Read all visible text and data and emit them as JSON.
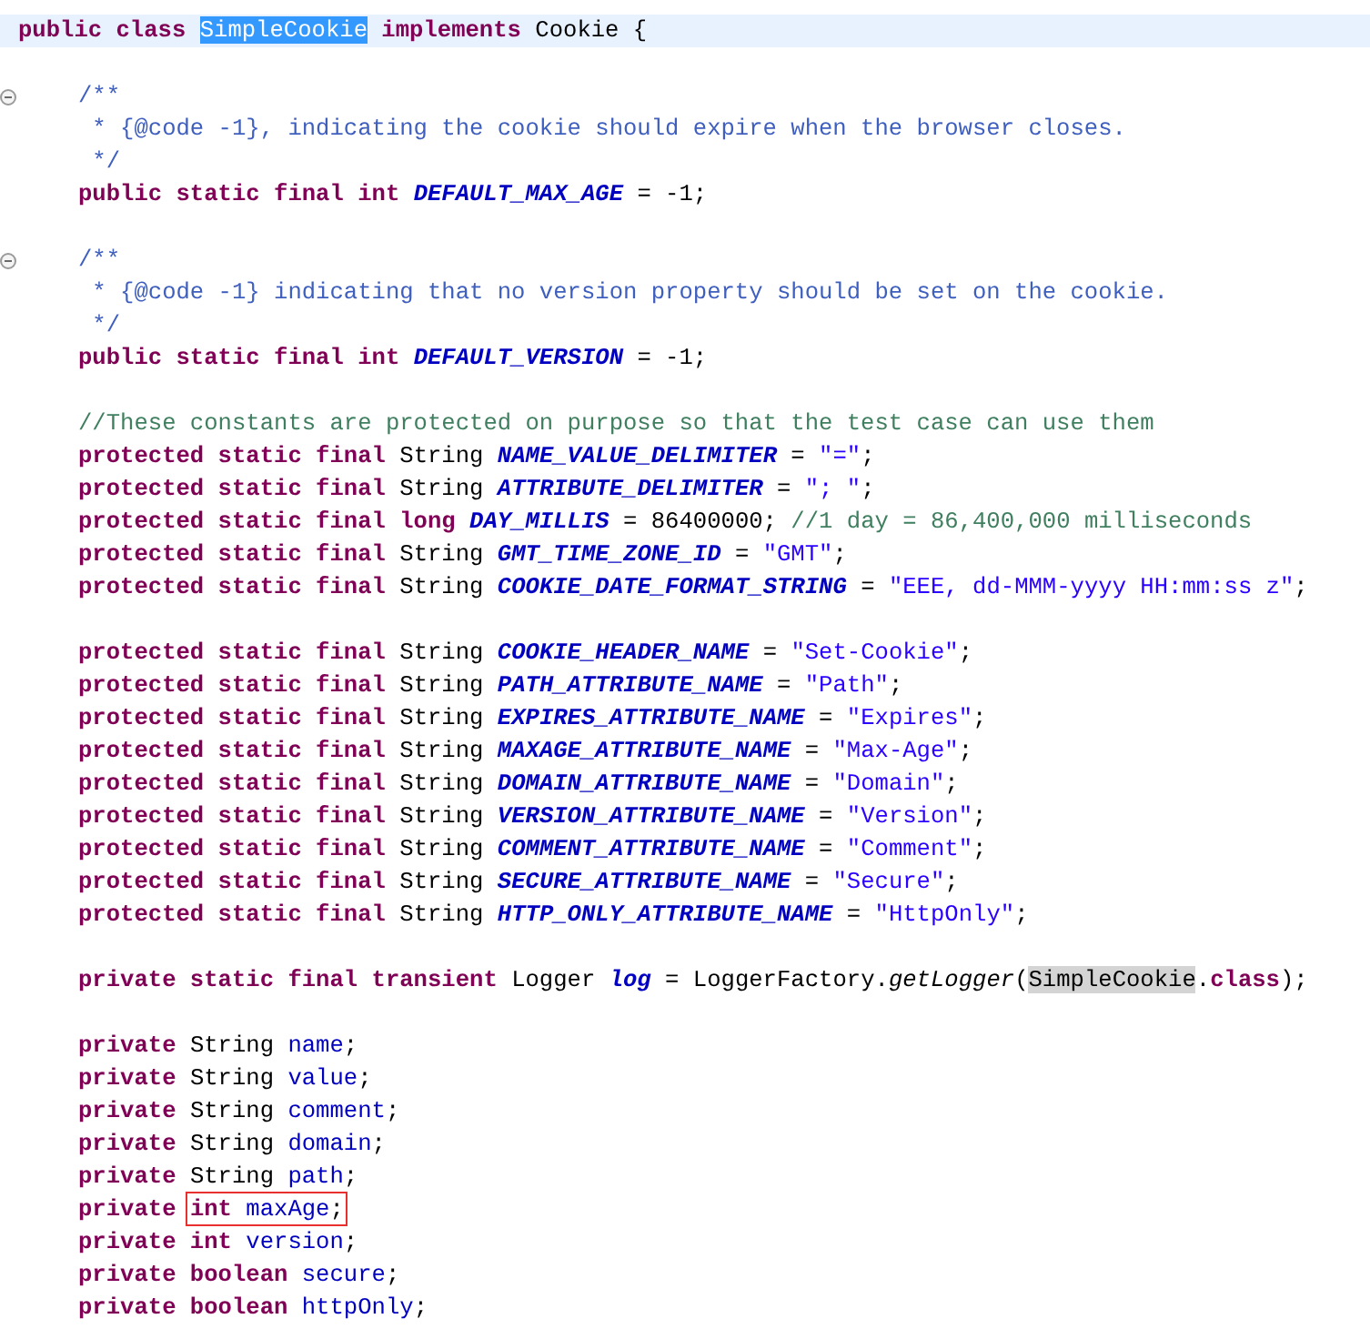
{
  "editor": {
    "lines": [
      {
        "kind": "code",
        "indented": false,
        "current": true,
        "foldable": false,
        "tokens": [
          {
            "kind": "keyword",
            "text": "public class "
          },
          {
            "kind": "plain",
            "text": "SimpleCookie",
            "selected": true
          },
          {
            "kind": "keyword",
            "text": " implements"
          },
          {
            "kind": "plain",
            "text": " Cookie {"
          }
        ]
      },
      {
        "kind": "blank"
      },
      {
        "kind": "code",
        "indented": true,
        "current": false,
        "foldable": true,
        "tokens": [
          {
            "kind": "doc",
            "text": "/**"
          }
        ]
      },
      {
        "kind": "code",
        "indented": true,
        "current": false,
        "foldable": false,
        "tokens": [
          {
            "kind": "doc",
            "text": " * {@code -1}, indicating the cookie should expire when the browser closes."
          }
        ]
      },
      {
        "kind": "code",
        "indented": true,
        "current": false,
        "foldable": false,
        "tokens": [
          {
            "kind": "doc",
            "text": " */"
          }
        ]
      },
      {
        "kind": "code",
        "indented": true,
        "current": false,
        "foldable": false,
        "tokens": [
          {
            "kind": "keyword",
            "text": "public static final int "
          },
          {
            "kind": "constant",
            "text": "DEFAULT_MAX_AGE"
          },
          {
            "kind": "plain",
            "text": " = -1;"
          }
        ]
      },
      {
        "kind": "blank"
      },
      {
        "kind": "code",
        "indented": true,
        "current": false,
        "foldable": true,
        "tokens": [
          {
            "kind": "doc",
            "text": "/**"
          }
        ]
      },
      {
        "kind": "code",
        "indented": true,
        "current": false,
        "foldable": false,
        "tokens": [
          {
            "kind": "doc",
            "text": " * {@code -1} indicating that no version property should be set on the cookie."
          }
        ]
      },
      {
        "kind": "code",
        "indented": true,
        "current": false,
        "foldable": false,
        "tokens": [
          {
            "kind": "doc",
            "text": " */"
          }
        ]
      },
      {
        "kind": "code",
        "indented": true,
        "current": false,
        "foldable": false,
        "tokens": [
          {
            "kind": "keyword",
            "text": "public static final int "
          },
          {
            "kind": "constant",
            "text": "DEFAULT_VERSION"
          },
          {
            "kind": "plain",
            "text": " = -1;"
          }
        ]
      },
      {
        "kind": "blank"
      },
      {
        "kind": "code",
        "indented": true,
        "current": false,
        "foldable": false,
        "tokens": [
          {
            "kind": "comment",
            "text": "//These constants are protected on purpose so that the test case can use them"
          }
        ]
      },
      {
        "kind": "code",
        "indented": true,
        "current": false,
        "foldable": false,
        "tokens": [
          {
            "kind": "keyword",
            "text": "protected static final "
          },
          {
            "kind": "plain",
            "text": "String "
          },
          {
            "kind": "constant",
            "text": "NAME_VALUE_DELIMITER"
          },
          {
            "kind": "plain",
            "text": " = "
          },
          {
            "kind": "string",
            "text": "\"=\""
          },
          {
            "kind": "plain",
            "text": ";"
          }
        ]
      },
      {
        "kind": "code",
        "indented": true,
        "current": false,
        "foldable": false,
        "tokens": [
          {
            "kind": "keyword",
            "text": "protected static final "
          },
          {
            "kind": "plain",
            "text": "String "
          },
          {
            "kind": "constant",
            "text": "ATTRIBUTE_DELIMITER"
          },
          {
            "kind": "plain",
            "text": " = "
          },
          {
            "kind": "string",
            "text": "\"; \""
          },
          {
            "kind": "plain",
            "text": ";"
          }
        ]
      },
      {
        "kind": "code",
        "indented": true,
        "current": false,
        "foldable": false,
        "tokens": [
          {
            "kind": "keyword",
            "text": "protected static final long "
          },
          {
            "kind": "constant",
            "text": "DAY_MILLIS"
          },
          {
            "kind": "plain",
            "text": " = 86400000; "
          },
          {
            "kind": "comment",
            "text": "//1 day = 86,400,000 milliseconds"
          }
        ]
      },
      {
        "kind": "code",
        "indented": true,
        "current": false,
        "foldable": false,
        "tokens": [
          {
            "kind": "keyword",
            "text": "protected static final "
          },
          {
            "kind": "plain",
            "text": "String "
          },
          {
            "kind": "constant",
            "text": "GMT_TIME_ZONE_ID"
          },
          {
            "kind": "plain",
            "text": " = "
          },
          {
            "kind": "string",
            "text": "\"GMT\""
          },
          {
            "kind": "plain",
            "text": ";"
          }
        ]
      },
      {
        "kind": "code",
        "indented": true,
        "current": false,
        "foldable": false,
        "tokens": [
          {
            "kind": "keyword",
            "text": "protected static final "
          },
          {
            "kind": "plain",
            "text": "String "
          },
          {
            "kind": "constant",
            "text": "COOKIE_DATE_FORMAT_STRING"
          },
          {
            "kind": "plain",
            "text": " = "
          },
          {
            "kind": "string",
            "text": "\"EEE, dd-MMM-yyyy HH:mm:ss z\""
          },
          {
            "kind": "plain",
            "text": ";"
          }
        ]
      },
      {
        "kind": "blank"
      },
      {
        "kind": "code",
        "indented": true,
        "current": false,
        "foldable": false,
        "tokens": [
          {
            "kind": "keyword",
            "text": "protected static final "
          },
          {
            "kind": "plain",
            "text": "String "
          },
          {
            "kind": "constant",
            "text": "COOKIE_HEADER_NAME"
          },
          {
            "kind": "plain",
            "text": " = "
          },
          {
            "kind": "string",
            "text": "\"Set-Cookie\""
          },
          {
            "kind": "plain",
            "text": ";"
          }
        ]
      },
      {
        "kind": "code",
        "indented": true,
        "current": false,
        "foldable": false,
        "tokens": [
          {
            "kind": "keyword",
            "text": "protected static final "
          },
          {
            "kind": "plain",
            "text": "String "
          },
          {
            "kind": "constant",
            "text": "PATH_ATTRIBUTE_NAME"
          },
          {
            "kind": "plain",
            "text": " = "
          },
          {
            "kind": "string",
            "text": "\"Path\""
          },
          {
            "kind": "plain",
            "text": ";"
          }
        ]
      },
      {
        "kind": "code",
        "indented": true,
        "current": false,
        "foldable": false,
        "tokens": [
          {
            "kind": "keyword",
            "text": "protected static final "
          },
          {
            "kind": "plain",
            "text": "String "
          },
          {
            "kind": "constant",
            "text": "EXPIRES_ATTRIBUTE_NAME"
          },
          {
            "kind": "plain",
            "text": " = "
          },
          {
            "kind": "string",
            "text": "\"Expires\""
          },
          {
            "kind": "plain",
            "text": ";"
          }
        ]
      },
      {
        "kind": "code",
        "indented": true,
        "current": false,
        "foldable": false,
        "tokens": [
          {
            "kind": "keyword",
            "text": "protected static final "
          },
          {
            "kind": "plain",
            "text": "String "
          },
          {
            "kind": "constant",
            "text": "MAXAGE_ATTRIBUTE_NAME"
          },
          {
            "kind": "plain",
            "text": " = "
          },
          {
            "kind": "string",
            "text": "\"Max-Age\""
          },
          {
            "kind": "plain",
            "text": ";"
          }
        ]
      },
      {
        "kind": "code",
        "indented": true,
        "current": false,
        "foldable": false,
        "tokens": [
          {
            "kind": "keyword",
            "text": "protected static final "
          },
          {
            "kind": "plain",
            "text": "String "
          },
          {
            "kind": "constant",
            "text": "DOMAIN_ATTRIBUTE_NAME"
          },
          {
            "kind": "plain",
            "text": " = "
          },
          {
            "kind": "string",
            "text": "\"Domain\""
          },
          {
            "kind": "plain",
            "text": ";"
          }
        ]
      },
      {
        "kind": "code",
        "indented": true,
        "current": false,
        "foldable": false,
        "tokens": [
          {
            "kind": "keyword",
            "text": "protected static final "
          },
          {
            "kind": "plain",
            "text": "String "
          },
          {
            "kind": "constant",
            "text": "VERSION_ATTRIBUTE_NAME"
          },
          {
            "kind": "plain",
            "text": " = "
          },
          {
            "kind": "string",
            "text": "\"Version\""
          },
          {
            "kind": "plain",
            "text": ";"
          }
        ]
      },
      {
        "kind": "code",
        "indented": true,
        "current": false,
        "foldable": false,
        "tokens": [
          {
            "kind": "keyword",
            "text": "protected static final "
          },
          {
            "kind": "plain",
            "text": "String "
          },
          {
            "kind": "constant",
            "text": "COMMENT_ATTRIBUTE_NAME"
          },
          {
            "kind": "plain",
            "text": " = "
          },
          {
            "kind": "string",
            "text": "\"Comment\""
          },
          {
            "kind": "plain",
            "text": ";"
          }
        ]
      },
      {
        "kind": "code",
        "indented": true,
        "current": false,
        "foldable": false,
        "tokens": [
          {
            "kind": "keyword",
            "text": "protected static final "
          },
          {
            "kind": "plain",
            "text": "String "
          },
          {
            "kind": "constant",
            "text": "SECURE_ATTRIBUTE_NAME"
          },
          {
            "kind": "plain",
            "text": " = "
          },
          {
            "kind": "string",
            "text": "\"Secure\""
          },
          {
            "kind": "plain",
            "text": ";"
          }
        ]
      },
      {
        "kind": "code",
        "indented": true,
        "current": false,
        "foldable": false,
        "tokens": [
          {
            "kind": "keyword",
            "text": "protected static final "
          },
          {
            "kind": "plain",
            "text": "String "
          },
          {
            "kind": "constant",
            "text": "HTTP_ONLY_ATTRIBUTE_NAME"
          },
          {
            "kind": "plain",
            "text": " = "
          },
          {
            "kind": "string",
            "text": "\"HttpOnly\""
          },
          {
            "kind": "plain",
            "text": ";"
          }
        ]
      },
      {
        "kind": "blank"
      },
      {
        "kind": "code",
        "indented": true,
        "current": false,
        "foldable": false,
        "tokens": [
          {
            "kind": "keyword",
            "text": "private static final transient "
          },
          {
            "kind": "plain",
            "text": "Logger "
          },
          {
            "kind": "constant",
            "text": "log"
          },
          {
            "kind": "plain",
            "text": " = LoggerFactory."
          },
          {
            "kind": "static_method",
            "text": "getLogger"
          },
          {
            "kind": "plain",
            "text": "("
          },
          {
            "kind": "plain",
            "text": "SimpleCookie",
            "occurrence_highlight": true
          },
          {
            "kind": "plain",
            "text": "."
          },
          {
            "kind": "keyword",
            "text": "class"
          },
          {
            "kind": "plain",
            "text": ");"
          }
        ]
      },
      {
        "kind": "blank"
      },
      {
        "kind": "code",
        "indented": true,
        "current": false,
        "foldable": false,
        "tokens": [
          {
            "kind": "keyword",
            "text": "private "
          },
          {
            "kind": "plain",
            "text": "String "
          },
          {
            "kind": "field",
            "text": "name"
          },
          {
            "kind": "plain",
            "text": ";"
          }
        ]
      },
      {
        "kind": "code",
        "indented": true,
        "current": false,
        "foldable": false,
        "tokens": [
          {
            "kind": "keyword",
            "text": "private "
          },
          {
            "kind": "plain",
            "text": "String "
          },
          {
            "kind": "field",
            "text": "value"
          },
          {
            "kind": "plain",
            "text": ";"
          }
        ]
      },
      {
        "kind": "code",
        "indented": true,
        "current": false,
        "foldable": false,
        "tokens": [
          {
            "kind": "keyword",
            "text": "private "
          },
          {
            "kind": "plain",
            "text": "String "
          },
          {
            "kind": "field",
            "text": "comment"
          },
          {
            "kind": "plain",
            "text": ";"
          }
        ]
      },
      {
        "kind": "code",
        "indented": true,
        "current": false,
        "foldable": false,
        "tokens": [
          {
            "kind": "keyword",
            "text": "private "
          },
          {
            "kind": "plain",
            "text": "String "
          },
          {
            "kind": "field",
            "text": "domain"
          },
          {
            "kind": "plain",
            "text": ";"
          }
        ]
      },
      {
        "kind": "code",
        "indented": true,
        "current": false,
        "foldable": false,
        "tokens": [
          {
            "kind": "keyword",
            "text": "private "
          },
          {
            "kind": "plain",
            "text": "String "
          },
          {
            "kind": "field",
            "text": "path"
          },
          {
            "kind": "plain",
            "text": ";"
          }
        ]
      },
      {
        "kind": "code",
        "indented": true,
        "current": false,
        "foldable": false,
        "tokens": [
          {
            "kind": "keyword",
            "text": "private "
          },
          {
            "kind": "boxed",
            "children": [
              {
                "kind": "keyword",
                "text": "int "
              },
              {
                "kind": "field",
                "text": "maxAge"
              },
              {
                "kind": "plain",
                "text": ";"
              }
            ]
          }
        ]
      },
      {
        "kind": "code",
        "indented": true,
        "current": false,
        "foldable": false,
        "tokens": [
          {
            "kind": "keyword",
            "text": "private int "
          },
          {
            "kind": "field",
            "text": "version"
          },
          {
            "kind": "plain",
            "text": ";"
          }
        ]
      },
      {
        "kind": "code",
        "indented": true,
        "current": false,
        "foldable": false,
        "tokens": [
          {
            "kind": "keyword",
            "text": "private boolean "
          },
          {
            "kind": "field",
            "text": "secure"
          },
          {
            "kind": "plain",
            "text": ";"
          }
        ]
      },
      {
        "kind": "code",
        "indented": true,
        "current": false,
        "foldable": false,
        "tokens": [
          {
            "kind": "keyword",
            "text": "private boolean "
          },
          {
            "kind": "field",
            "text": "httpOnly"
          },
          {
            "kind": "plain",
            "text": ";"
          }
        ]
      }
    ]
  }
}
